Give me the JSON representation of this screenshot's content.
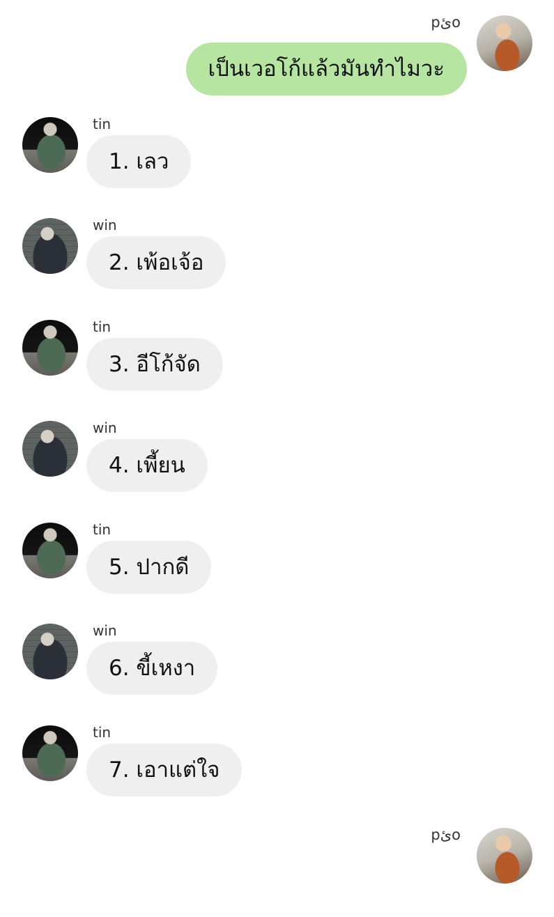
{
  "messages": [
    {
      "sender": "pئo",
      "side": "out",
      "text": "เป็นเวอโก้แล้วมันทำไมวะ"
    },
    {
      "sender": "tin",
      "side": "in",
      "text": "1. เลว"
    },
    {
      "sender": "win",
      "side": "in",
      "text": "2. เพ้อเจ้อ"
    },
    {
      "sender": "tin",
      "side": "in",
      "text": "3. อีโก้จัด"
    },
    {
      "sender": "win",
      "side": "in",
      "text": "4. เพี้ยน"
    },
    {
      "sender": "tin",
      "side": "in",
      "text": "5. ปากดี"
    },
    {
      "sender": "win",
      "side": "in",
      "text": "6. ขี้เหงา"
    },
    {
      "sender": "tin",
      "side": "in",
      "text": "7. เอาแต่ใจ"
    },
    {
      "sender": "pئo",
      "side": "out",
      "text": ""
    }
  ],
  "colors": {
    "incoming_bubble": "#efefef",
    "outgoing_bubble": "#b6e5a2"
  }
}
